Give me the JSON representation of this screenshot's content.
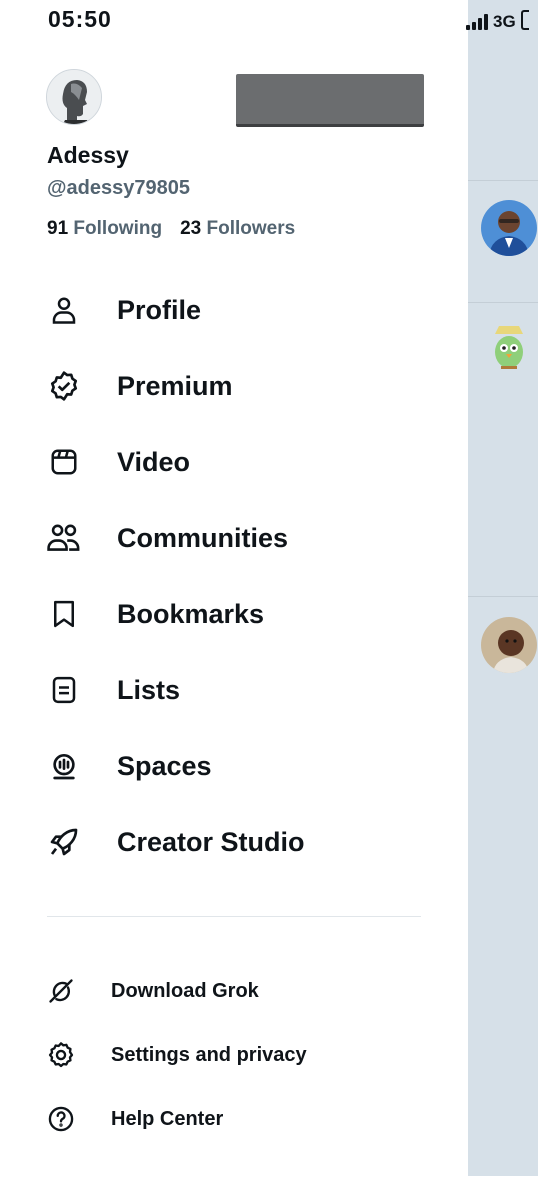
{
  "status_bar": {
    "time": "05:50",
    "network": "3G"
  },
  "account": {
    "name": "Adessy",
    "handle": "@adessy79805",
    "following_count": "91",
    "following_label": "Following",
    "followers_count": "23",
    "followers_label": "Followers"
  },
  "menu": {
    "items": [
      {
        "label": "Profile",
        "icon": "person-icon"
      },
      {
        "label": "Premium",
        "icon": "verified-badge-icon"
      },
      {
        "label": "Video",
        "icon": "video-icon"
      },
      {
        "label": "Communities",
        "icon": "communities-icon"
      },
      {
        "label": "Bookmarks",
        "icon": "bookmark-icon"
      },
      {
        "label": "Lists",
        "icon": "list-icon"
      },
      {
        "label": "Spaces",
        "icon": "spaces-microphone-icon"
      },
      {
        "label": "Creator Studio",
        "icon": "rocket-icon"
      }
    ],
    "secondary": [
      {
        "label": "Download Grok",
        "icon": "grok-icon"
      },
      {
        "label": "Settings and privacy",
        "icon": "gear-icon"
      },
      {
        "label": "Help Center",
        "icon": "help-icon"
      }
    ]
  },
  "colors": {
    "text": "#0f1419",
    "muted": "#536471",
    "backdrop": "#d6e0e8"
  }
}
